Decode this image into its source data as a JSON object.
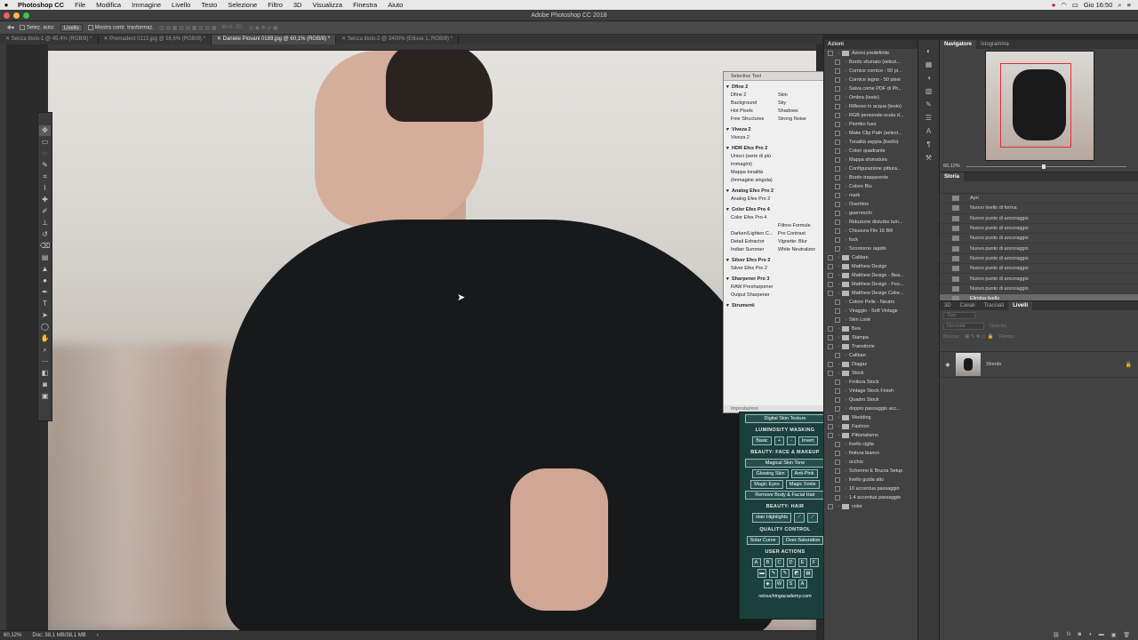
{
  "menubar": {
    "app_name": "Photoshop CC",
    "items": [
      "File",
      "Modifica",
      "Immagine",
      "Livello",
      "Testo",
      "Selezione",
      "Filtro",
      "3D",
      "Visualizza",
      "Finestra",
      "Aiuto"
    ],
    "clock": "Gio 16:50"
  },
  "window_title": "Adobe Photoshop CC 2018",
  "options_bar": {
    "auto_select_label": "Selez. auto:",
    "auto_select_value": "Livello",
    "show_transform_label": "Mostra contr. trasformaz.",
    "mode_3d_label": "Mod. 3D:"
  },
  "doc_tabs": [
    {
      "label": "Senza titolo-1 @ 45,4% (RGB/8) *",
      "active": false
    },
    {
      "label": "Premadent 0113.jpg @ 56,6% (RGB/8) *",
      "active": false
    },
    {
      "label": "Daniele Piovani 0189.jpg @ 60,1% (RGB/8) *",
      "active": true
    },
    {
      "label": "Senza titolo-2 @ 3400% (Ellisse 1, RGB/8) *",
      "active": false
    }
  ],
  "status": {
    "zoom": "60,12%",
    "doc": "Doc: 38,1 MB/38,1 MB"
  },
  "selective_tool": {
    "title": "Selective Tool",
    "sections": [
      {
        "name": "Dfine 2",
        "rows": [
          [
            "Dfine 2",
            "Skin"
          ],
          [
            "Background",
            "Sky"
          ],
          [
            "Hot Pixels",
            "Shadows"
          ],
          [
            "Fine Structures",
            "Strong Noise"
          ]
        ]
      },
      {
        "name": "Viveza 2",
        "rows": [
          [
            "Viveza 2",
            ""
          ]
        ]
      },
      {
        "name": "HDR Efex Pro 2",
        "rows": [
          [
            "Unisci (serie di più immagini)",
            ""
          ],
          [
            "Mappa tonalità (Immagine singola)",
            ""
          ]
        ]
      },
      {
        "name": "Analog Efex Pro 2",
        "rows": [
          [
            "Analog Efex Pro 2",
            ""
          ]
        ]
      },
      {
        "name": "Color Efex Pro 4",
        "rows": [
          [
            "Color Efex Pro 4",
            ""
          ],
          [
            "",
            "Filtros  Formule"
          ],
          [
            "Darken/Lighten C...",
            "Pro Contrast"
          ],
          [
            "Detail Extractor",
            "Vignette: Blur"
          ],
          [
            "Indian Summer",
            "White Neutralizer"
          ]
        ]
      },
      {
        "name": "Silver Efex Pro 2",
        "rows": [
          [
            "Silver Efex Pro 2",
            ""
          ]
        ]
      },
      {
        "name": "Sharpener Pro 3",
        "rows": [
          [
            "RAW Presharpener",
            ""
          ],
          [
            "Output Sharpener",
            ""
          ]
        ]
      },
      {
        "name": "Strumenti",
        "rows": []
      }
    ],
    "footer": "Impostazioni"
  },
  "beauty_panel": {
    "top_button": "Digital Skin Texture",
    "lum_header": "LUMINOSITY  MASKING",
    "lum_buttons": [
      "Basic",
      "+",
      "-",
      "Invert"
    ],
    "face_header": "BEAUTY: FACE & MAKEUP",
    "face_button": "Magical Skin Tone",
    "face_pairs": [
      [
        "Glowing Skin",
        "Anti-Pink"
      ],
      [
        "Magic Eyes",
        "Magic Smile"
      ]
    ],
    "remove_button": "Remove Body & Facial Hair",
    "hair_header": "BEAUTY: HAIR",
    "hair_button": "Hair Highlights",
    "quality_header": "QUALITY CONTROL",
    "quality_buttons": [
      "Solar Curve",
      "Over-Saturation"
    ],
    "user_header": "USER  ACTIONS",
    "user_keys": [
      "A",
      "B",
      "C",
      "D",
      "E",
      "F"
    ],
    "site": "retouchingacademy.com"
  },
  "azioni": {
    "title": "Azioni",
    "items": [
      {
        "t": "Azioni predefinite",
        "k": "folder"
      },
      {
        "t": "Bordo sfumato (selezi...",
        "k": "item"
      },
      {
        "t": "Cornice cornice - 50 pi...",
        "k": "item"
      },
      {
        "t": "Cornice legno - 50 pixel",
        "k": "item"
      },
      {
        "t": "Salva come PDF di Ph...",
        "k": "item"
      },
      {
        "t": "Ombra (testo)",
        "k": "item"
      },
      {
        "t": "Riflesso in acqua (testo)",
        "k": "item"
      },
      {
        "t": "RGB personale-scala d...",
        "k": "item"
      },
      {
        "t": "Piombo fuso",
        "k": "item"
      },
      {
        "t": "Make Clip Path (select...",
        "k": "item"
      },
      {
        "t": "Tonalità seppia (livello)",
        "k": "item"
      },
      {
        "t": "Colori quadrante",
        "k": "item"
      },
      {
        "t": "Mappa sfumatura",
        "k": "item"
      },
      {
        "t": "Configurazione pittura...",
        "k": "item"
      },
      {
        "t": "Bordo trasparente",
        "k": "item"
      },
      {
        "t": "Colore Blu",
        "k": "item"
      },
      {
        "t": "mark",
        "k": "item"
      },
      {
        "t": "Overtime",
        "k": "item"
      },
      {
        "t": "guerreschi",
        "k": "item"
      },
      {
        "t": "Riduzione disturbo lum...",
        "k": "item"
      },
      {
        "t": "Chiusura File 16 BR",
        "k": "item"
      },
      {
        "t": "fuck",
        "k": "item"
      },
      {
        "t": "Scontorno rapido",
        "k": "item"
      },
      {
        "t": "Caliban",
        "k": "folder"
      },
      {
        "t": "Matthew Design",
        "k": "folder"
      },
      {
        "t": "Matthew Design - Bea...",
        "k": "folder"
      },
      {
        "t": "Matthew Design - Foo...",
        "k": "folder"
      },
      {
        "t": "Matthew Design Color...",
        "k": "folder"
      },
      {
        "t": "Colore Pelle - Neutro",
        "k": "item"
      },
      {
        "t": "Viraggio - Soft Vintage",
        "k": "item"
      },
      {
        "t": "Skin Look",
        "k": "item"
      },
      {
        "t": "Bea",
        "k": "folder"
      },
      {
        "t": "Stampa",
        "k": "folder"
      },
      {
        "t": "Transitorie",
        "k": "folder"
      },
      {
        "t": "Caliban",
        "k": "item"
      },
      {
        "t": "Diagaz",
        "k": "folder"
      },
      {
        "t": "Stock",
        "k": "folder"
      },
      {
        "t": "Finitura Stock",
        "k": "item"
      },
      {
        "t": "Vintage Stock Finish",
        "k": "item"
      },
      {
        "t": "Quadro Stock",
        "k": "item"
      },
      {
        "t": "doppio passaggio acc...",
        "k": "item"
      },
      {
        "t": "Wedding",
        "k": "folder"
      },
      {
        "t": "Fashion",
        "k": "folder"
      },
      {
        "t": "Pittorialismo",
        "k": "folder"
      },
      {
        "t": "livello ciglia",
        "k": "item"
      },
      {
        "t": "finitura bianco",
        "k": "item"
      },
      {
        "t": "occhio",
        "k": "item"
      },
      {
        "t": "Schermo E Brucia Setup",
        "k": "item"
      },
      {
        "t": "livello guida alto",
        "k": "item"
      },
      {
        "t": "10 accentua passaggio",
        "k": "item"
      },
      {
        "t": "1.4 accentua passaggio",
        "k": "item"
      },
      {
        "t": "color",
        "k": "folder"
      }
    ]
  },
  "navigator": {
    "tabs": [
      "Navigatore",
      "Istogramma"
    ],
    "zoom": "60,12%"
  },
  "storia": {
    "title": "Storia",
    "items": [
      "Apri",
      "Nuovo livello di forma",
      "Nuovo punto di ancoraggio",
      "Nuovo punto di ancoraggio",
      "Nuovo punto di ancoraggio",
      "Nuovo punto di ancoraggio",
      "Nuovo punto di ancoraggio",
      "Nuovo punto di ancoraggio",
      "Nuovo punto di ancoraggio",
      "Nuovo punto di ancoraggio",
      "Elimina livello"
    ],
    "selected_index": 10
  },
  "livelli": {
    "tabs": [
      "3D",
      "Canali",
      "Tracciati",
      "Livelli"
    ],
    "search": "Tipo",
    "blend": "Normale",
    "opacity_label": "Opacità:",
    "lock_label": "Blocca:",
    "fill_label": "Riemp.:",
    "layer_name": "Sfondo"
  }
}
